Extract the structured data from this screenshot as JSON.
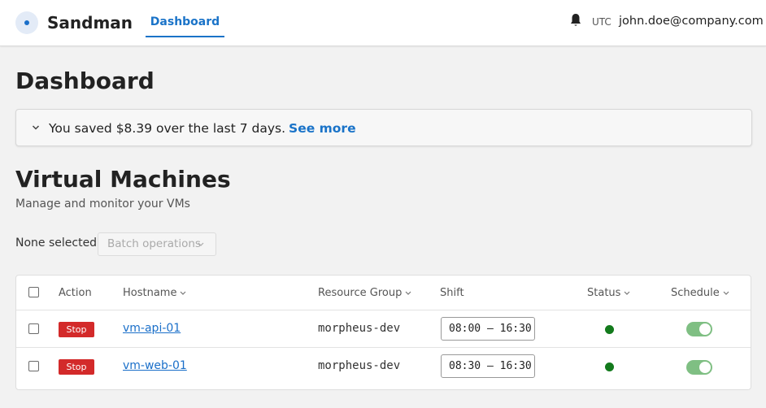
{
  "header": {
    "app_name": "Sandman",
    "nav_tab": "Dashboard",
    "timezone": "UTC",
    "user_email": "john.doe@company.com"
  },
  "page_title": "Dashboard",
  "savings": {
    "text": "You saved $8.39 over the last 7 days.",
    "link": "See more"
  },
  "vms": {
    "title": "Virtual Machines",
    "subtitle": "Manage and monitor your VMs",
    "selection_label": "None selected",
    "batch_label": "Batch operations",
    "columns": {
      "action": "Action",
      "hostname": "Hostname",
      "resource_group": "Resource Group",
      "shift": "Shift",
      "status": "Status",
      "schedule": "Schedule"
    },
    "rows": [
      {
        "action": "Stop",
        "hostname": "vm-api-01",
        "resource_group": "morpheus-dev",
        "shift": "08:00 – 16:30",
        "status_color": "#137a1c",
        "schedule_on": true
      },
      {
        "action": "Stop",
        "hostname": "vm-web-01",
        "resource_group": "morpheus-dev",
        "shift": "08:30 – 16:30",
        "status_color": "#137a1c",
        "schedule_on": true
      }
    ]
  },
  "colors": {
    "accent": "#1a73c8",
    "danger": "#d32a2a",
    "status_running": "#137a1c",
    "toggle_on": "#7fbf83"
  },
  "icons": [
    "logo-icon",
    "bell-icon",
    "chevron-down-icon",
    "sort-caret-icon",
    "status-dot-icon"
  ]
}
